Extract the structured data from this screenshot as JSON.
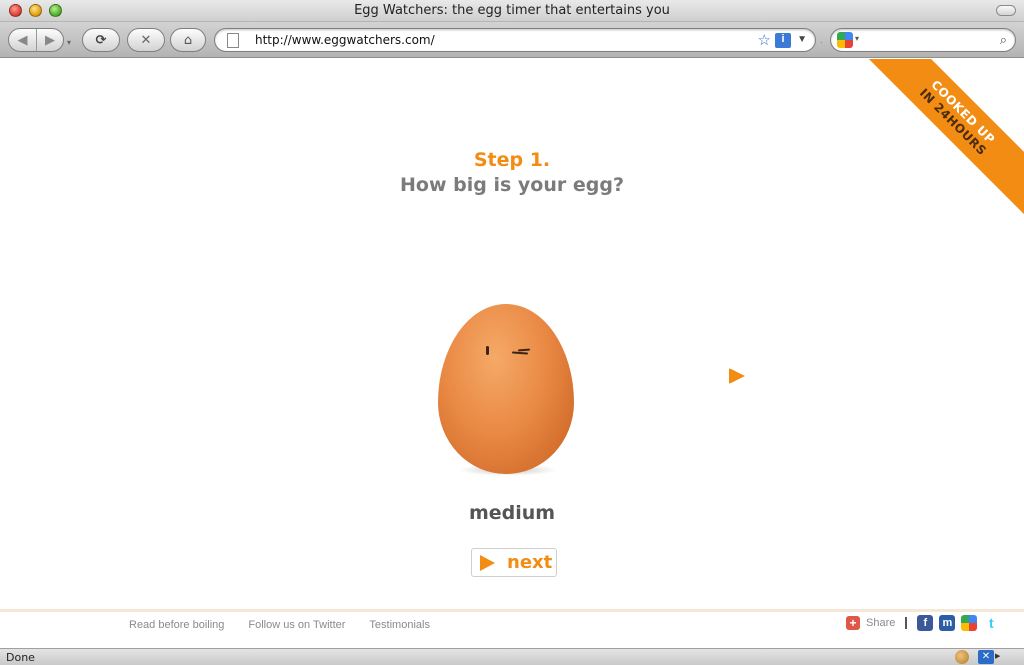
{
  "window": {
    "title": "Egg Watchers: the egg timer that entertains you"
  },
  "toolbar": {
    "url": "http://www.eggwatchers.com/"
  },
  "ribbon": {
    "line1": "COOKED UP",
    "line2": "IN 24HOURS",
    "color": "#f28c13"
  },
  "main": {
    "step": "Step 1.",
    "question": "How big is your egg?",
    "egg_size": "medium",
    "next_label": "next",
    "accent_color": "#f28c13"
  },
  "footer": {
    "links": [
      "Read before boiling",
      "Follow us on Twitter",
      "Testimonials"
    ],
    "share_label": "Share",
    "social_icons": [
      "facebook-icon",
      "myspace-icon",
      "google-icon",
      "twitter-icon"
    ]
  },
  "status": {
    "text": "Done"
  }
}
